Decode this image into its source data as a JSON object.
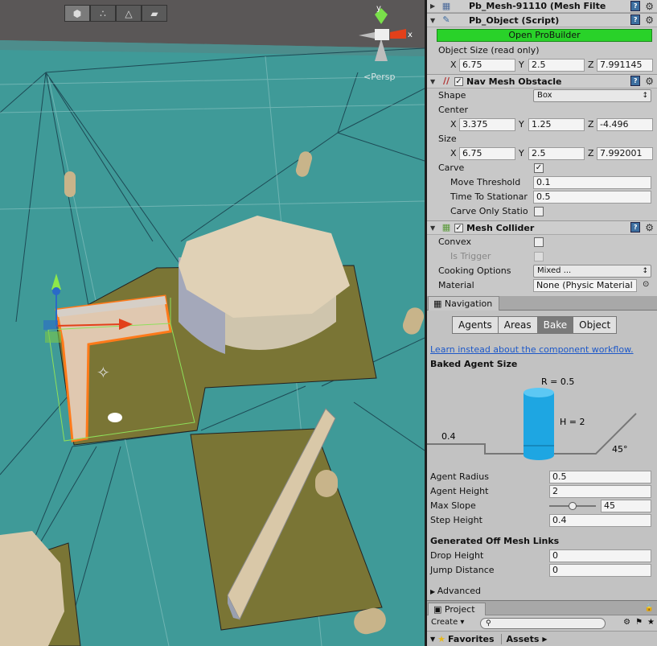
{
  "scene": {
    "toolbar": [
      {
        "name": "cube-icon",
        "glyph": "⬢",
        "active": true
      },
      {
        "name": "vertex-icon",
        "glyph": "∴",
        "active": false
      },
      {
        "name": "edge-icon",
        "glyph": "△",
        "active": false
      },
      {
        "name": "face-icon",
        "glyph": "▰",
        "active": false
      }
    ],
    "persp_label": "Persp"
  },
  "inspector": {
    "mesh_filter": {
      "title": "Pb_Mesh-91110 (Mesh Filte"
    },
    "pb_object": {
      "title": "Pb_Object (Script)",
      "open_button": "Open ProBuilder",
      "size_label": "Object Size (read only)",
      "size": {
        "x": "6.75",
        "y": "2.5",
        "z": "7.991145"
      }
    },
    "nav_mesh_obstacle": {
      "title": "Nav Mesh Obstacle",
      "shape_label": "Shape",
      "shape_value": "Box",
      "center_label": "Center",
      "center": {
        "x": "3.375",
        "y": "1.25",
        "z": "-4.496"
      },
      "size_label": "Size",
      "size": {
        "x": "6.75",
        "y": "2.5",
        "z": "7.992001"
      },
      "carve_label": "Carve",
      "move_threshold_label": "Move Threshold",
      "move_threshold": "0.1",
      "time_to_stationary_label": "Time To Stationar",
      "time_to_stationary": "0.5",
      "carve_only_label": "Carve Only Statio"
    },
    "mesh_collider": {
      "title": "Mesh Collider",
      "convex_label": "Convex",
      "is_trigger_label": "Is Trigger",
      "cooking_label": "Cooking Options",
      "cooking_value": "Mixed ...",
      "material_label": "Material",
      "material_value": "None (Physic Material"
    },
    "axis": {
      "x": "X",
      "y": "Y",
      "z": "Z"
    }
  },
  "navigation": {
    "tab": "Navigation",
    "segments": [
      "Agents",
      "Areas",
      "Bake",
      "Object"
    ],
    "selected": "Bake",
    "link": "Learn instead about the component workflow.",
    "baked_title": "Baked Agent Size",
    "fig": {
      "r": "R = 0.5",
      "h": "H = 2",
      "step": "0.4",
      "slope": "45°"
    },
    "fields": [
      {
        "label": "Agent Radius",
        "value": "0.5"
      },
      {
        "label": "Agent Height",
        "value": "2"
      },
      {
        "label": "Max Slope",
        "value": "45",
        "slider": 0.5
      },
      {
        "label": "Step Height",
        "value": "0.4"
      }
    ],
    "offmesh_title": "Generated Off Mesh Links",
    "offmesh": [
      {
        "label": "Drop Height",
        "value": "0"
      },
      {
        "label": "Jump Distance",
        "value": "0"
      }
    ],
    "advanced": "Advanced"
  },
  "project": {
    "tab": "Project",
    "create": "Create",
    "favorites": "Favorites",
    "assets": "Assets"
  }
}
